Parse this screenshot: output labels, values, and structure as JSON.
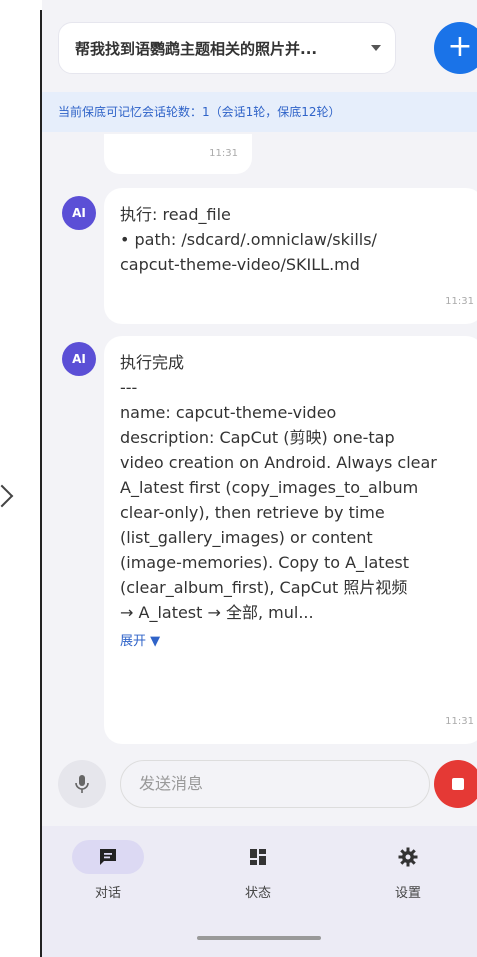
{
  "header": {
    "conversation_title": "帮我找到语鹦鹉主题相关的照片并...",
    "new_button_label": "+"
  },
  "memory_banner": "当前保底可记忆会话轮数：1（会话1轮，保底12轮）",
  "chat": {
    "stub_time": "11:31",
    "messages": [
      {
        "avatar": "AI",
        "lines": [
          "执行: read_file",
          "  • path: /sdcard/.omniclaw/skills/",
          "capcut-theme-video/SKILL.md"
        ],
        "time": "11:31"
      },
      {
        "avatar": "AI",
        "lines": [
          "执行完成",
          "---",
          "name: capcut-theme-video",
          "description: CapCut (剪映) one-tap",
          "video creation on Android. Always clear",
          "A_latest first (copy_images_to_album",
          "clear-only), then retrieve by time",
          "(list_gallery_images) or content",
          "(image-memories). Copy to A_latest",
          "(clear_album_first), CapCut 照片视频",
          "→ A_latest → 全部, mul..."
        ],
        "expand_label": "展开 ▼",
        "time": "11:31"
      }
    ]
  },
  "input": {
    "placeholder": "发送消息"
  },
  "nav": {
    "items": [
      {
        "label": "对话",
        "icon": "chat-icon",
        "active": true
      },
      {
        "label": "状态",
        "icon": "dashboard-icon",
        "active": false
      },
      {
        "label": "设置",
        "icon": "gear-icon",
        "active": false
      }
    ]
  },
  "colors": {
    "accent": "#1a73e8",
    "avatar": "#5b4fd6",
    "stop": "#e53935",
    "banner_text": "#2f63c8"
  }
}
